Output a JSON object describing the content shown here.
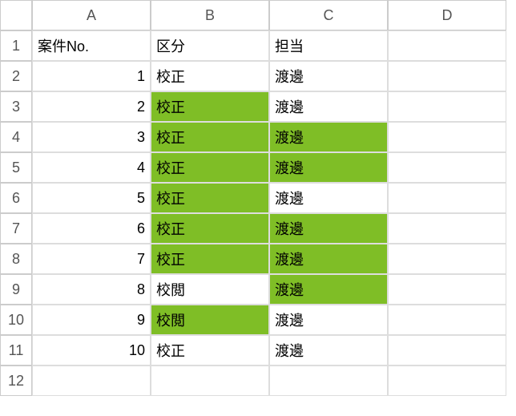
{
  "columns": [
    "A",
    "B",
    "C",
    "D"
  ],
  "row_numbers": [
    1,
    2,
    3,
    4,
    5,
    6,
    7,
    8,
    9,
    10,
    11,
    12
  ],
  "headers": {
    "A": "案件No.",
    "B": "区分",
    "C": "担当"
  },
  "rows": [
    {
      "a": 1,
      "b": "校正",
      "c": "渡邊",
      "b_hl": false,
      "c_hl": false
    },
    {
      "a": 2,
      "b": "校正",
      "c": "渡邊",
      "b_hl": true,
      "c_hl": false
    },
    {
      "a": 3,
      "b": "校正",
      "c": "渡邊",
      "b_hl": true,
      "c_hl": true
    },
    {
      "a": 4,
      "b": "校正",
      "c": "渡邊",
      "b_hl": true,
      "c_hl": true
    },
    {
      "a": 5,
      "b": "校正",
      "c": "渡邊",
      "b_hl": true,
      "c_hl": false
    },
    {
      "a": 6,
      "b": "校正",
      "c": "渡邊",
      "b_hl": true,
      "c_hl": true
    },
    {
      "a": 7,
      "b": "校正",
      "c": "渡邊",
      "b_hl": true,
      "c_hl": true
    },
    {
      "a": 8,
      "b": "校閲",
      "c": "渡邊",
      "b_hl": false,
      "c_hl": true
    },
    {
      "a": 9,
      "b": "校閲",
      "c": "渡邊",
      "b_hl": true,
      "c_hl": false
    },
    {
      "a": 10,
      "b": "校正",
      "c": "渡邊",
      "b_hl": false,
      "c_hl": false
    }
  ]
}
